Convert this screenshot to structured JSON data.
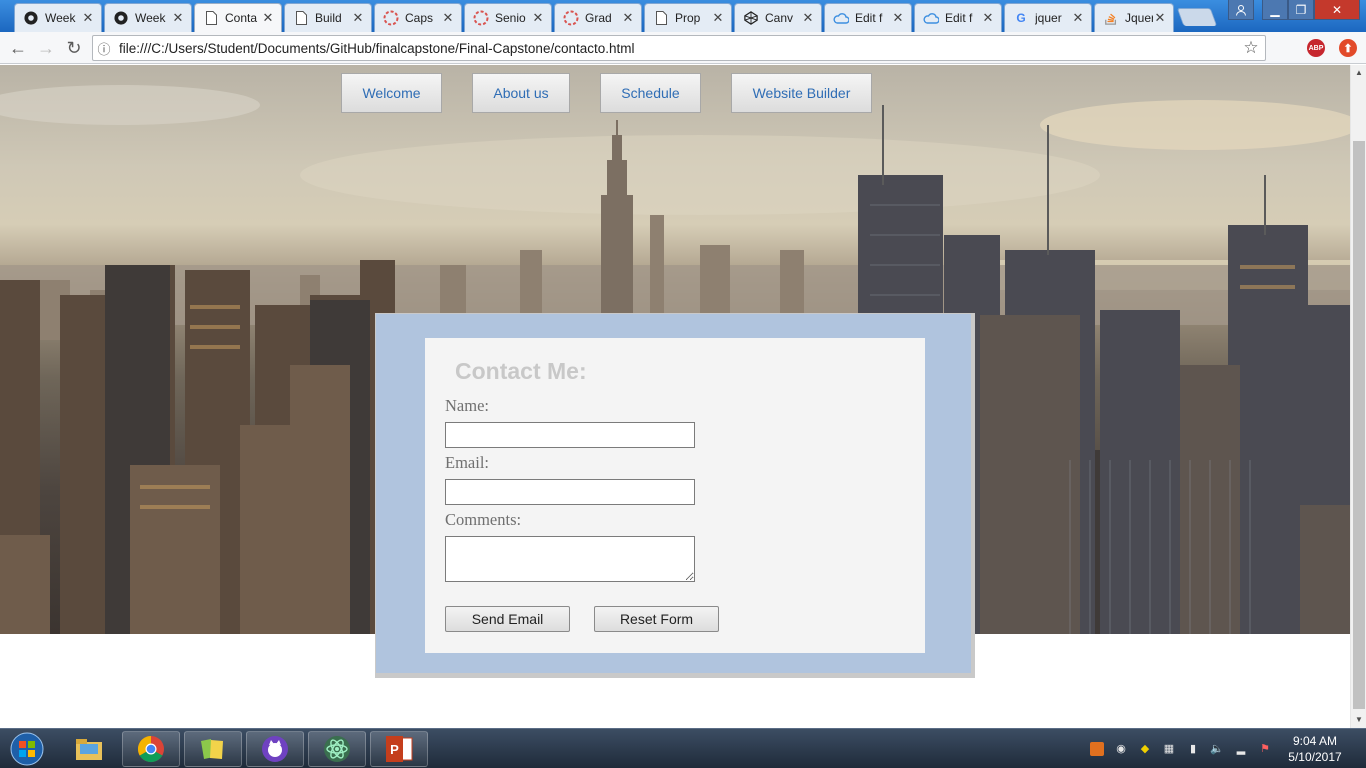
{
  "browser": {
    "tabs": [
      {
        "title": "Week",
        "icon": "github-icon"
      },
      {
        "title": "Week",
        "icon": "github-icon"
      },
      {
        "title": "Conta",
        "icon": "page-icon",
        "active": true
      },
      {
        "title": "Build",
        "icon": "page-icon"
      },
      {
        "title": "Caps",
        "icon": "loading-icon"
      },
      {
        "title": "Senio",
        "icon": "loading-icon"
      },
      {
        "title": "Grad",
        "icon": "loading-icon"
      },
      {
        "title": "Prop",
        "icon": "page-icon"
      },
      {
        "title": "Canv",
        "icon": "codepen-icon"
      },
      {
        "title": "Edit f",
        "icon": "cloud-icon"
      },
      {
        "title": "Edit f",
        "icon": "cloud-icon"
      },
      {
        "title": "jquer",
        "icon": "google-icon"
      },
      {
        "title": "Jquer",
        "icon": "stackoverflow-icon"
      }
    ],
    "url": "file:///C:/Users/Student/Documents/GitHub/finalcapstone/Final-Capstone/contacto.html",
    "extensions": {
      "abp": "ABP"
    }
  },
  "page": {
    "nav": [
      "Welcome",
      "About us",
      "Schedule",
      "Website Builder"
    ],
    "contact": {
      "title": "Contact Me:",
      "name_label": "Name:",
      "email_label": "Email:",
      "comments_label": "Comments:",
      "name_value": "",
      "email_value": "",
      "comments_value": "",
      "send_label": "Send Email",
      "reset_label": "Reset Form"
    }
  },
  "taskbar": {
    "apps": [
      "explorer",
      "chrome",
      "file-manager",
      "github-desktop",
      "atom",
      "powerpoint"
    ],
    "clock": {
      "time": "9:04 AM",
      "date": "5/10/2017"
    }
  }
}
